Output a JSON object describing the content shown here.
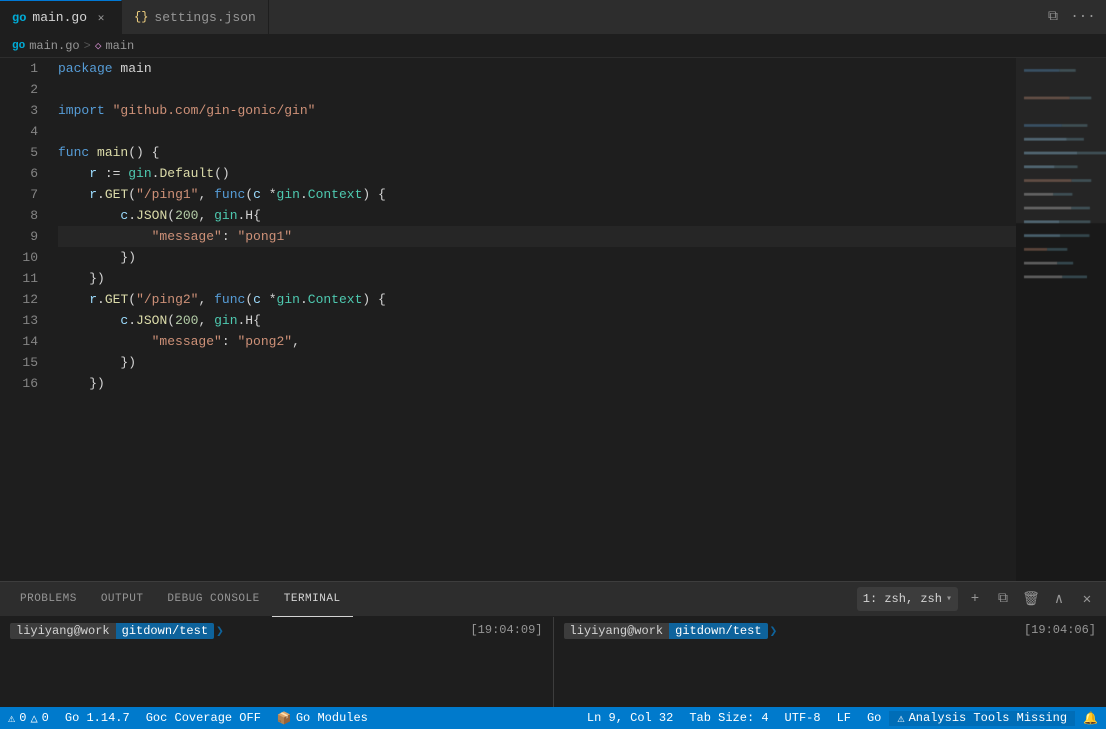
{
  "tabs": [
    {
      "id": "main-go",
      "label": "main.go",
      "type": "go",
      "active": true,
      "icon": "go-icon"
    },
    {
      "id": "settings-json",
      "label": "settings.json",
      "type": "json",
      "active": false,
      "icon": "json-icon"
    }
  ],
  "breadcrumb": {
    "file": "main.go",
    "separator": ">",
    "symbol": "main"
  },
  "editor": {
    "lines": [
      {
        "num": 1,
        "tokens": [
          {
            "t": "kw",
            "v": "package"
          },
          {
            "t": "plain",
            "v": " main"
          }
        ]
      },
      {
        "num": 2,
        "tokens": []
      },
      {
        "num": 3,
        "tokens": [
          {
            "t": "kw",
            "v": "import"
          },
          {
            "t": "plain",
            "v": " "
          },
          {
            "t": "import-path",
            "v": "\"github.com/gin-gonic/gin\""
          }
        ]
      },
      {
        "num": 4,
        "tokens": []
      },
      {
        "num": 5,
        "tokens": [
          {
            "t": "kw",
            "v": "func"
          },
          {
            "t": "plain",
            "v": " "
          },
          {
            "t": "fn",
            "v": "main"
          },
          {
            "t": "plain",
            "v": "() {"
          }
        ]
      },
      {
        "num": 6,
        "tokens": [
          {
            "t": "plain",
            "v": "    "
          },
          {
            "t": "var",
            "v": "r"
          },
          {
            "t": "plain",
            "v": " := "
          },
          {
            "t": "pkg",
            "v": "gin"
          },
          {
            "t": "plain",
            "v": "."
          },
          {
            "t": "fn",
            "v": "Default"
          },
          {
            "t": "plain",
            "v": "()"
          }
        ]
      },
      {
        "num": 7,
        "tokens": [
          {
            "t": "plain",
            "v": "    "
          },
          {
            "t": "var",
            "v": "r"
          },
          {
            "t": "plain",
            "v": "."
          },
          {
            "t": "fn",
            "v": "GET"
          },
          {
            "t": "plain",
            "v": "("
          },
          {
            "t": "str",
            "v": "\"/ping1\""
          },
          {
            "t": "plain",
            "v": ", "
          },
          {
            "t": "kw",
            "v": "func"
          },
          {
            "t": "plain",
            "v": "("
          },
          {
            "t": "var",
            "v": "c"
          },
          {
            "t": "plain",
            "v": " *"
          },
          {
            "t": "pkg",
            "v": "gin"
          },
          {
            "t": "plain",
            "v": "."
          },
          {
            "t": "type",
            "v": "Context"
          },
          {
            "t": "plain",
            "v": ") {"
          }
        ]
      },
      {
        "num": 8,
        "tokens": [
          {
            "t": "plain",
            "v": "        "
          },
          {
            "t": "var",
            "v": "c"
          },
          {
            "t": "plain",
            "v": "."
          },
          {
            "t": "fn",
            "v": "JSON"
          },
          {
            "t": "plain",
            "v": "("
          },
          {
            "t": "num",
            "v": "200"
          },
          {
            "t": "plain",
            "v": ", "
          },
          {
            "t": "pkg",
            "v": "gin"
          },
          {
            "t": "plain",
            "v": ".H{"
          }
        ]
      },
      {
        "num": 9,
        "tokens": [
          {
            "t": "plain",
            "v": "            "
          },
          {
            "t": "str",
            "v": "\"message\""
          },
          {
            "t": "plain",
            "v": ": "
          },
          {
            "t": "str",
            "v": "\"pong1\""
          }
        ],
        "highlighted": true
      },
      {
        "num": 10,
        "tokens": [
          {
            "t": "plain",
            "v": "        })"
          }
        ]
      },
      {
        "num": 11,
        "tokens": [
          {
            "t": "plain",
            "v": "    })"
          }
        ]
      },
      {
        "num": 12,
        "tokens": [
          {
            "t": "plain",
            "v": "    "
          },
          {
            "t": "var",
            "v": "r"
          },
          {
            "t": "plain",
            "v": "."
          },
          {
            "t": "fn",
            "v": "GET"
          },
          {
            "t": "plain",
            "v": "("
          },
          {
            "t": "str",
            "v": "\"/ping2\""
          },
          {
            "t": "plain",
            "v": ", "
          },
          {
            "t": "kw",
            "v": "func"
          },
          {
            "t": "plain",
            "v": "("
          },
          {
            "t": "var",
            "v": "c"
          },
          {
            "t": "plain",
            "v": " *"
          },
          {
            "t": "pkg",
            "v": "gin"
          },
          {
            "t": "plain",
            "v": "."
          },
          {
            "t": "type",
            "v": "Context"
          },
          {
            "t": "plain",
            "v": ") {"
          }
        ]
      },
      {
        "num": 13,
        "tokens": [
          {
            "t": "plain",
            "v": "        "
          },
          {
            "t": "var",
            "v": "c"
          },
          {
            "t": "plain",
            "v": "."
          },
          {
            "t": "fn",
            "v": "JSON"
          },
          {
            "t": "plain",
            "v": "("
          },
          {
            "t": "num",
            "v": "200"
          },
          {
            "t": "plain",
            "v": ", "
          },
          {
            "t": "pkg",
            "v": "gin"
          },
          {
            "t": "plain",
            "v": ".H{"
          }
        ]
      },
      {
        "num": 14,
        "tokens": [
          {
            "t": "plain",
            "v": "            "
          },
          {
            "t": "str",
            "v": "\"message\""
          },
          {
            "t": "plain",
            "v": ": "
          },
          {
            "t": "str",
            "v": "\"pong2\""
          },
          {
            "t": "plain",
            "v": ","
          }
        ]
      },
      {
        "num": 15,
        "tokens": [
          {
            "t": "plain",
            "v": "        })"
          }
        ]
      },
      {
        "num": 16,
        "tokens": [
          {
            "t": "plain",
            "v": "    })"
          }
        ]
      }
    ]
  },
  "panel": {
    "tabs": [
      "PROBLEMS",
      "OUTPUT",
      "DEBUG CONSOLE",
      "TERMINAL"
    ],
    "active_tab": "TERMINAL",
    "terminal_select": "1: zsh, zsh"
  },
  "terminals": [
    {
      "user": "liyiyang@work",
      "path": "gitdown/test",
      "timestamp": "[19:04:09]"
    },
    {
      "user": "liyiyang@work",
      "path": "gitdown/test",
      "timestamp": "[19:04:06]"
    }
  ],
  "status_bar": {
    "errors": "0",
    "warnings": "0",
    "go_version": "Go 1.14.7",
    "goc_coverage": "Goc Coverage OFF",
    "go_modules": "Go Modules",
    "position": "Ln 9, Col 32",
    "tab_size": "Tab Size: 4",
    "encoding": "UTF-8",
    "line_ending": "LF",
    "language": "Go",
    "analysis_tools": "Analysis Tools Missing",
    "notifications": ""
  }
}
